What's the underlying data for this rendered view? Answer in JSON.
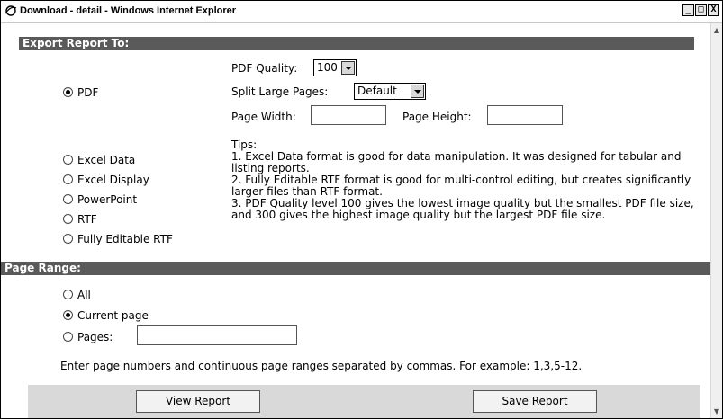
{
  "window": {
    "title": "Download - detail - Windows Internet Explorer",
    "min_symbol": "_",
    "max_symbol": "□",
    "close_symbol": "X"
  },
  "export": {
    "header": "Export Report To:",
    "pdf_quality_label": "PDF Quality:",
    "pdf_quality_value": "100",
    "split_pages_label": "Split Large Pages:",
    "split_pages_value": "Default",
    "page_width_label": "Page Width:",
    "page_width_value": "",
    "page_height_label": "Page Height:",
    "page_height_value": "",
    "formats": [
      {
        "label": "PDF",
        "checked": true
      },
      {
        "label": "Excel Data",
        "checked": false
      },
      {
        "label": "Excel Display",
        "checked": false
      },
      {
        "label": "PowerPoint",
        "checked": false
      },
      {
        "label": "RTF",
        "checked": false
      },
      {
        "label": "Fully Editable RTF",
        "checked": false
      }
    ],
    "tips": [
      "Tips:",
      "1. Excel Data format is good for data manipulation. It was designed for tabular and listing reports.",
      "2. Fully Editable RTF format is good for multi-control editing, but creates significantly larger files than RTF format.",
      "3. PDF Quality level 100 gives the lowest image quality but the smallest PDF file size, and 300 gives the highest image quality but the largest PDF file size."
    ]
  },
  "page_range": {
    "header": "Page Range:",
    "options": [
      {
        "label": "All",
        "checked": false
      },
      {
        "label": "Current page",
        "checked": true
      },
      {
        "label": "Pages:",
        "checked": false
      }
    ],
    "pages_value": "",
    "hint": "Enter page numbers and continuous page ranges separated by commas. For example: 1,3,5-12."
  },
  "buttons": {
    "view_report": "View Report",
    "save_report": "Save Report"
  }
}
